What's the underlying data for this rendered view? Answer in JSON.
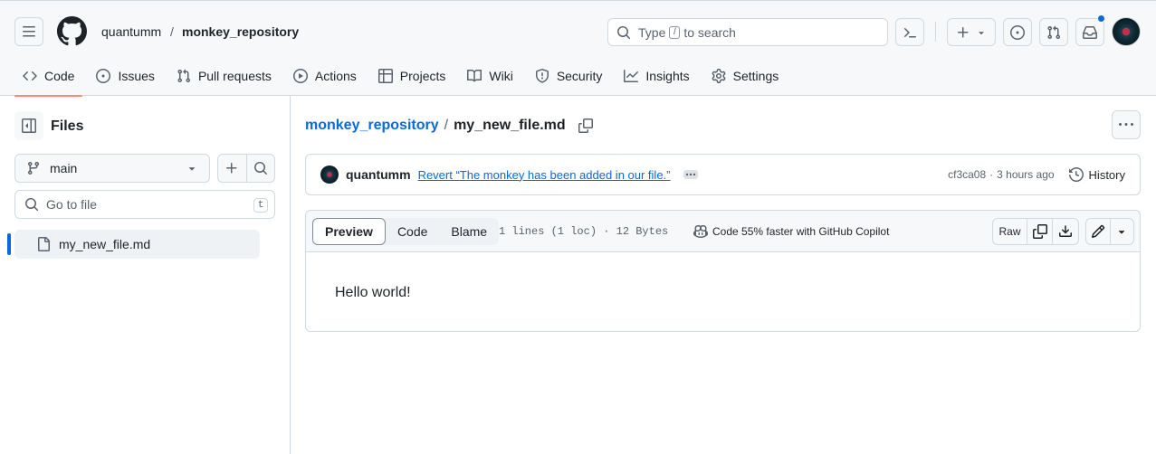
{
  "header": {
    "owner": "quantumm",
    "separator": "/",
    "repo": "monkey_repository",
    "search_prefix": "Type",
    "search_key": "/",
    "search_suffix": "to search"
  },
  "tabs": [
    {
      "label": "Code",
      "icon": "code-icon",
      "active": true
    },
    {
      "label": "Issues",
      "icon": "issue-opened-icon"
    },
    {
      "label": "Pull requests",
      "icon": "git-pull-request-icon"
    },
    {
      "label": "Actions",
      "icon": "play-icon"
    },
    {
      "label": "Projects",
      "icon": "table-icon"
    },
    {
      "label": "Wiki",
      "icon": "book-icon"
    },
    {
      "label": "Security",
      "icon": "shield-icon"
    },
    {
      "label": "Insights",
      "icon": "graph-icon"
    },
    {
      "label": "Settings",
      "icon": "gear-icon"
    }
  ],
  "sidebar": {
    "title": "Files",
    "branch": "main",
    "go_to_file_placeholder": "Go to file",
    "go_to_file_key": "t",
    "tree": [
      {
        "name": "my_new_file.md",
        "selected": true
      }
    ]
  },
  "main": {
    "path_repo": "monkey_repository",
    "path_sep": "/",
    "path_file": "my_new_file.md",
    "commit": {
      "author": "quantumm",
      "message": "Revert “The monkey has been added in our file.”",
      "sha": "cf3ca08",
      "dot": "·",
      "time": "3 hours ago",
      "history_label": "History"
    },
    "file": {
      "view_tabs": [
        "Preview",
        "Code",
        "Blame"
      ],
      "active_view": "Preview",
      "stats": "1 lines (1 loc) · 12 Bytes",
      "copilot_text": "Code 55% faster with GitHub Copilot",
      "raw_label": "Raw",
      "content": "Hello world!"
    }
  },
  "colors": {
    "accent": "#0969da",
    "tab_underline": "#fd8c73",
    "border": "#d1d9e0",
    "muted": "#59636e"
  }
}
